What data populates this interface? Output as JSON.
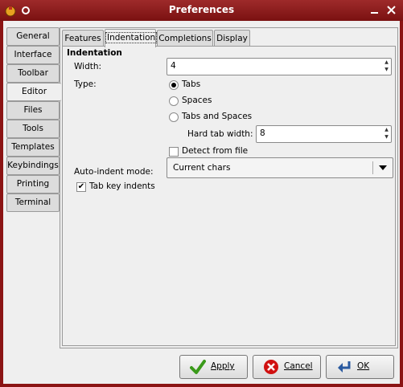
{
  "window": {
    "title": "Preferences"
  },
  "side_tabs": [
    "General",
    "Interface",
    "Toolbar",
    "Editor",
    "Files",
    "Tools",
    "Templates",
    "Keybindings",
    "Printing",
    "Terminal"
  ],
  "side_tab_selected": "Editor",
  "top_tabs": [
    "Features",
    "Indentation",
    "Completions",
    "Display"
  ],
  "top_tab_selected": "Indentation",
  "indentation": {
    "section_title": "Indentation",
    "width_label": "Width:",
    "width_value": "4",
    "type_label": "Type:",
    "type_options": [
      "Tabs",
      "Spaces",
      "Tabs and Spaces"
    ],
    "type_selected": "Tabs",
    "hard_tab_label": "Hard tab width:",
    "hard_tab_value": "8",
    "detect_label": "Detect from file",
    "detect_checked": false,
    "autoindent_label": "Auto-indent mode:",
    "autoindent_value": "Current chars",
    "tabkey_label": "Tab key indents",
    "tabkey_checked": true
  },
  "buttons": {
    "apply": "Apply",
    "cancel": "Cancel",
    "ok": "OK"
  },
  "colors": {
    "titlebar": "#8b1414",
    "background": "#efefef",
    "apply_icon": "#3a9a1a",
    "cancel_icon": "#d01010",
    "ok_icon": "#2a5aa0"
  }
}
